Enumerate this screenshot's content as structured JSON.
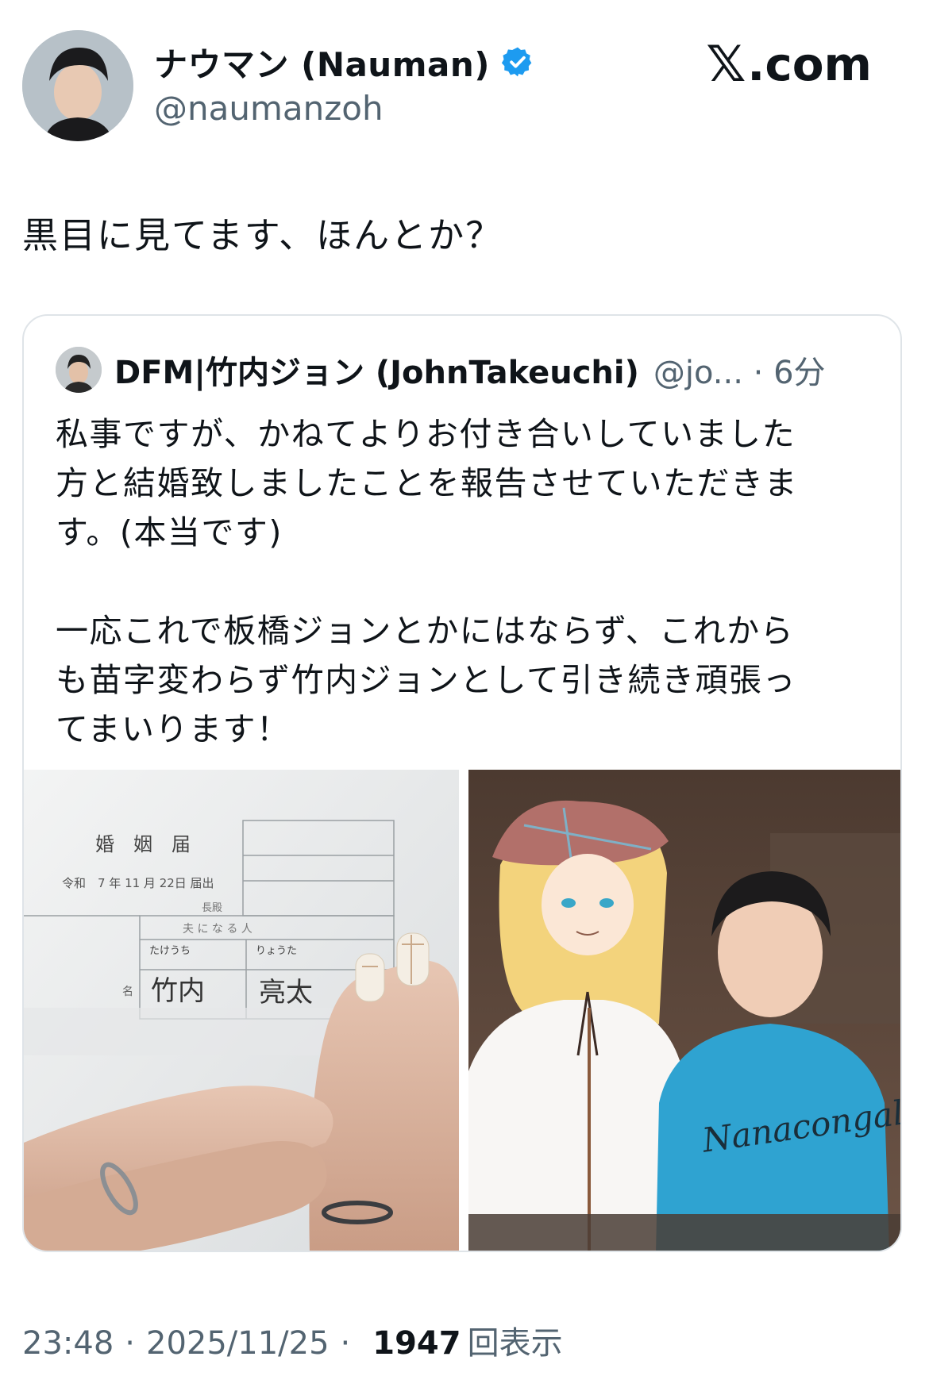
{
  "header": {
    "display_name": "ナウマン (Nauman)",
    "handle": "@naumanzoh",
    "site_name": ".com",
    "site_mark": "𝕏",
    "verified_color": "#1d9bf0"
  },
  "tweet": {
    "text": "黒目に見てます、ほんとか？"
  },
  "quote": {
    "display_name": "DFM|竹内ジョン (JohnTakeuchi)",
    "handle_time": "@jo... · 6分",
    "paragraph1": [
      "私事ですが、かねてよりお付き合いしていました",
      "方と結婚致しましたことを報告させていただきま",
      "す。(本当です)"
    ],
    "paragraph2": [
      "一応これで板橋ジョンとかにはならず、これから",
      "も苗字変わらず竹内ジョンとして引き続き頑張っ",
      "てまいります！"
    ],
    "media": {
      "left_form": {
        "title": "婚　姻　届",
        "date_line": "令和　7 年 11 月 22日 届出",
        "nagadono": "長殿",
        "husband_header": "夫 に な る 人",
        "furigana_surname": "たけうち",
        "furigana_given": "りょうた",
        "surname": "竹内",
        "given_name": "亮太",
        "label_name": "名"
      },
      "right_shirt_text": "Nanacongales"
    }
  },
  "footer": {
    "time": "23:48",
    "date": "2025/11/25",
    "sep": "·",
    "views": "1947",
    "views_label": "回表示"
  }
}
